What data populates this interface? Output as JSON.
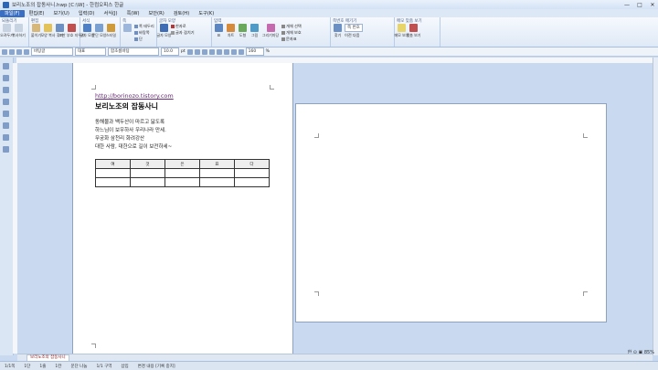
{
  "window": {
    "title": "보리노조의 잡동사니.hwp [C:\\W] - 한컴오피스 한글",
    "buttons": [
      "—",
      "□",
      "✕"
    ]
  },
  "menubar": {
    "items": [
      "파일(F)",
      "편집(E)",
      "보기(U)",
      "입력(D)",
      "서식(J)",
      "쪽(W)",
      "보안(R)",
      "검토(H)",
      "도구(K)"
    ],
    "active_index": 0
  },
  "ribbon": {
    "groups": [
      {
        "label": "되돌리기",
        "buttons": [
          "오려두기",
          "복사하기"
        ]
      },
      {
        "label": "편집",
        "buttons": [
          "붙이기",
          "모양 복사",
          "찾기",
          "조판 부호 지우기"
        ]
      },
      {
        "label": "서식",
        "buttons": [
          "글자 모양",
          "문단 모양",
          "스타일"
        ]
      },
      {
        "label": "쪽",
        "items": [
          "쪽 테두리",
          "바탕쪽",
          "단"
        ]
      },
      {
        "label": "글자 모양",
        "buttons": [
          "글자 모양"
        ],
        "items": [
          "한자로",
          "글자 겹치기"
        ]
      },
      {
        "label": "입력",
        "buttons": [
          "표",
          "차트",
          "도형",
          "그림",
          "그리기마당"
        ],
        "items": [
          "개체 선택",
          "개체 보호",
          "문자표"
        ]
      },
      {
        "label": "쪽번호 매기기",
        "items": [
          "쪽 번호",
          "이전",
          "다음"
        ],
        "select": "쪽 번호",
        "buttons": [
          "찾기"
        ]
      },
      {
        "label": "메모 맞춤 보기",
        "buttons": [
          "메모 보기",
          "맞춤 보기"
        ]
      }
    ]
  },
  "toolbar": {
    "style_select": "바탕글",
    "lang_select": "대표",
    "font_select": "함초롬바탕",
    "size_value": "10.0",
    "unit": "pt",
    "line_spacing": "160",
    "percent": "%"
  },
  "document": {
    "link": "http://borinozo.tistory.com",
    "title": "보리노조의 잡동사니",
    "lines": [
      "동해물과 백두산이 마르고 닳도록",
      "하느님이 보우하사 우리나라 만세.",
      "무궁화 삼천리 화려강산",
      "대한 사람, 대한으로 길이 보전하세~"
    ],
    "table_header": [
      "여",
      "것",
      "은",
      "표",
      "다"
    ],
    "table_rows": 2
  },
  "sheet_tab": "보리노조의 잡동사니",
  "status": {
    "page": "1/1쪽",
    "section": "1단",
    "line": "1줄",
    "col": "1칸",
    "chars": "문단 나눔",
    "mode": "1/1 구역",
    "insert": "삽입",
    "track": "변경 내용 [기록 중지]"
  },
  "zoom": "한 ⊙ ▣ 85%"
}
